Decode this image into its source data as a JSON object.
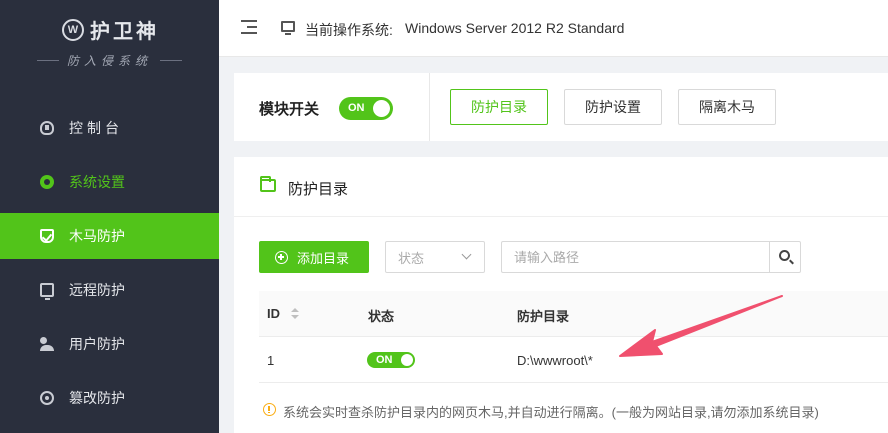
{
  "sidebar": {
    "logo_badge": "W",
    "app_name": "护卫神",
    "subtitle": "防入侵系统",
    "items": [
      {
        "label": "控制台",
        "icon": "dashboard-icon"
      },
      {
        "label": "系统设置",
        "icon": "gear-icon"
      },
      {
        "label": "木马防护",
        "icon": "shield-icon"
      },
      {
        "label": "远程防护",
        "icon": "monitor-icon"
      },
      {
        "label": "用户防护",
        "icon": "users-icon"
      },
      {
        "label": "篡改防护",
        "icon": "tamper-icon"
      }
    ],
    "active_color": "#52c41a"
  },
  "header": {
    "os_label": "当前操作系统:",
    "os_value": "Windows Server 2012 R2 Standard"
  },
  "module": {
    "label": "模块开关",
    "toggle_text": "ON",
    "tabs": [
      "防护目录",
      "防护设置",
      "隔离木马"
    ]
  },
  "panel": {
    "title": "防护目录",
    "add_button": "添加目录",
    "status_select": "状态",
    "path_placeholder": "请输入路径",
    "columns": [
      "ID",
      "状态",
      "防护目录"
    ],
    "rows": [
      {
        "id": "1",
        "status": "ON",
        "path": "D:\\wwwroot\\*"
      }
    ],
    "note": "系统会实时查杀防护目录内的网页木马,并自动进行隔离。(一般为网站目录,请勿添加系统目录)"
  },
  "colors": {
    "accent": "#52c41a",
    "sidebar_bg": "#2a2f3d",
    "warning": "#faad14",
    "annotation_arrow": "#f0506e"
  }
}
